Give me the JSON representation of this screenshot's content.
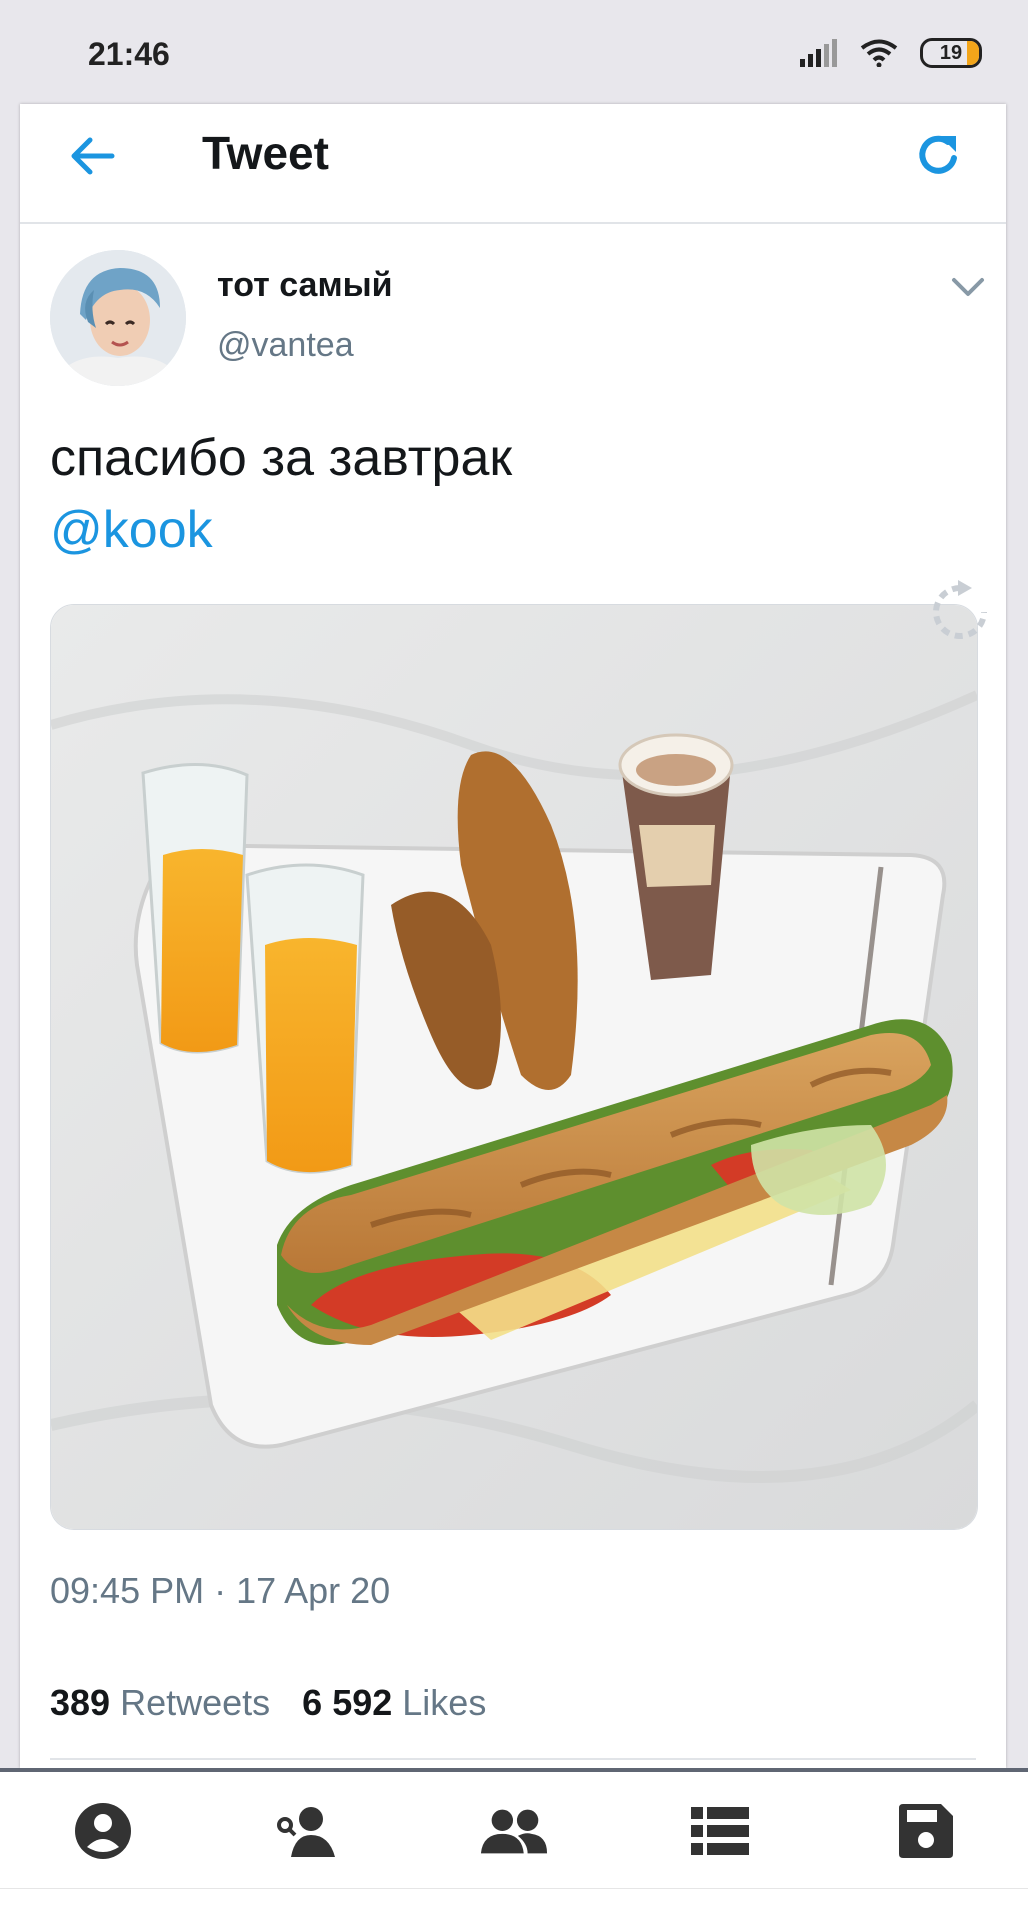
{
  "status_bar": {
    "time": "21:46",
    "battery": "19"
  },
  "header": {
    "title": "Tweet"
  },
  "tweet": {
    "author_name": "тот самый",
    "author_handle": "@vantea",
    "text": "спасибо за завтрак",
    "mention": "@kook",
    "timestamp": "09:45 PM · 17 Apr 20",
    "retweets_count": "389",
    "retweets_label": "Retweets",
    "likes_count": "6 592",
    "likes_label": "Likes"
  },
  "colors": {
    "accent": "#1b95e0",
    "secondary_text": "#657786"
  },
  "nav": {
    "items": [
      "profile-icon",
      "person-search-icon",
      "people-icon",
      "list-icon",
      "save-icon"
    ]
  }
}
